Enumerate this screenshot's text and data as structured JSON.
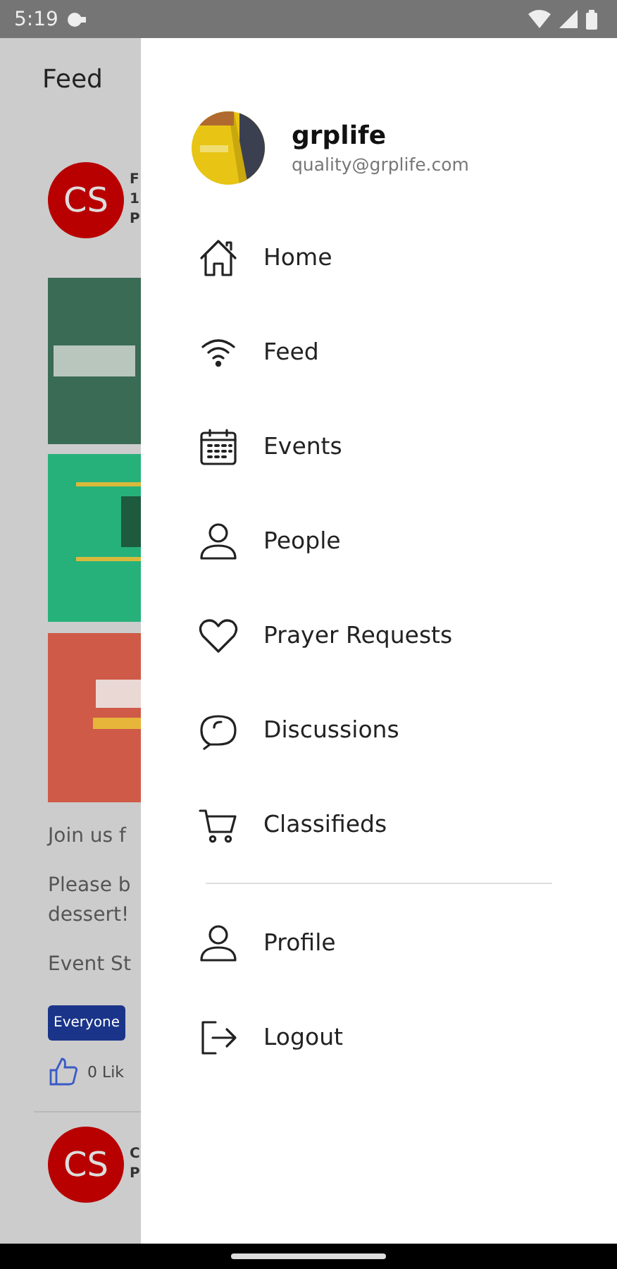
{
  "status_bar": {
    "time": "5:19"
  },
  "feed_screen": {
    "title": "Feed",
    "posts": [
      {
        "avatar": "CS",
        "lines": [
          "F",
          "1",
          "P"
        ],
        "texts": [
          "Join us f",
          "Please b\ndessert!",
          "Event St"
        ],
        "tag": "Everyone",
        "likes": "0 Lik"
      },
      {
        "avatar": "CS",
        "lines": [
          "C",
          "P"
        ]
      }
    ]
  },
  "drawer": {
    "user": {
      "name": "grplife",
      "email": "quality@grplife.com"
    },
    "menu": [
      {
        "label": "Home"
      },
      {
        "label": "Feed"
      },
      {
        "label": "Events"
      },
      {
        "label": "People"
      },
      {
        "label": "Prayer Requests"
      },
      {
        "label": "Discussions"
      },
      {
        "label": "Classifieds"
      }
    ],
    "account_menu": [
      {
        "label": "Profile"
      },
      {
        "label": "Logout"
      }
    ]
  }
}
